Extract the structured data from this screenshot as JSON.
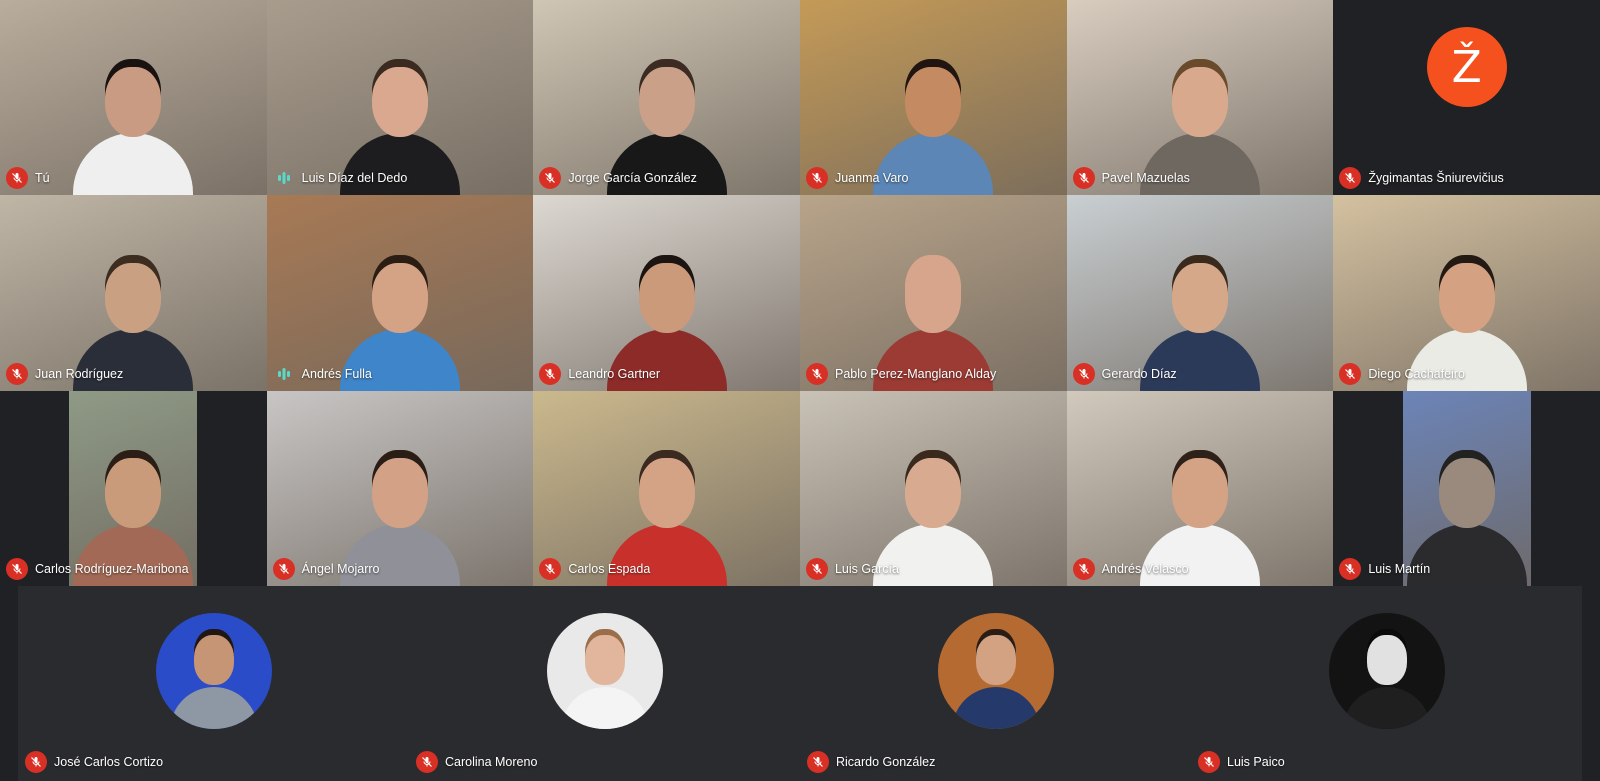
{
  "mic_icon": "mic-off-icon",
  "talking_icon": "audio-level-icon",
  "colors": {
    "background": "#202124",
    "mic_off": "#d93025",
    "speaking": "#5bd9c8",
    "avatar_letter_bg": "#f4511e"
  },
  "participants": [
    {
      "name": "Tú",
      "status": "muted",
      "bg": "#b9ad9c",
      "skin": "#c99b82",
      "shirt": "#efefef",
      "hair": "#1a1210"
    },
    {
      "name": "Luis Díaz del Dedo",
      "status": "speaking",
      "bg": "#a89d8d",
      "skin": "#d9a88e",
      "shirt": "#1d1d1f",
      "hair": "#3a2a20"
    },
    {
      "name": "Jorge García González",
      "status": "muted",
      "bg": "#cfc6b4",
      "skin": "#caa088",
      "shirt": "#181818",
      "hair": "#3b2b22"
    },
    {
      "name": "Juanma Varo",
      "status": "muted",
      "bg": "#c49a57",
      "skin": "#c48a62",
      "shirt": "#5b86b6",
      "hair": "#201510"
    },
    {
      "name": "Pavel Mazuelas",
      "status": "muted",
      "bg": "#d8cdbf",
      "skin": "#d9a98d",
      "shirt": "#6f6860",
      "hair": "#6a4a2d"
    },
    {
      "name": "Žygimantas Šniurevičius",
      "status": "muted",
      "avatar_letter": "Ž"
    },
    {
      "name": "Juan Rodríguez",
      "status": "muted",
      "bg": "#bfb6a6",
      "skin": "#caa083",
      "shirt": "#2a2e38",
      "hair": "#3d2c20"
    },
    {
      "name": "Andrés Fulla",
      "status": "speaking",
      "bg": "#a87a55",
      "skin": "#d4a284",
      "shirt": "#3f85c9",
      "hair": "#2c1d14"
    },
    {
      "name": "Leandro Gartner",
      "status": "muted",
      "bg": "#ddd8d2",
      "skin": "#cb9a7b",
      "shirt": "#8d2b28",
      "hair": "#1b1410"
    },
    {
      "name": "Pablo Perez-Manglano Alday",
      "status": "muted",
      "bg": "#b8a48a",
      "skin": "#d6a58c",
      "shirt": "#9b3b34",
      "hair": "#d6a58c"
    },
    {
      "name": "Gerardo Díaz",
      "status": "muted",
      "bg": "#c9cfd2",
      "skin": "#d5a88a",
      "shirt": "#2c3a5a",
      "hair": "#3a2a1e"
    },
    {
      "name": "Diego Cachafeiro",
      "status": "muted",
      "bg": "#d4c1a0",
      "skin": "#d4a282",
      "shirt": "#ebebe6",
      "hair": "#241a14"
    },
    {
      "name": "Carlos Rodríguez-Maribona",
      "status": "muted",
      "narrow": true,
      "bg": "#8e9a86",
      "skin": "#c99b7b",
      "shirt": "#a26a56",
      "hair": "#2a1e16"
    },
    {
      "name": "Ángel Mojarro",
      "status": "muted",
      "bg": "#c8c6c5",
      "skin": "#d2a186",
      "shirt": "#8f9098",
      "hair": "#2a1d15"
    },
    {
      "name": "Carlos Espada",
      "status": "muted",
      "bg": "#cbb98d",
      "skin": "#d4a385",
      "shirt": "#c8312b",
      "hair": "#3a2a20"
    },
    {
      "name": "Luis García",
      "status": "muted",
      "bg": "#c9c2b6",
      "skin": "#d8ab90",
      "shirt": "#f1f1ef",
      "hair": "#3a2a1e"
    },
    {
      "name": "Andrés Velasco",
      "status": "muted",
      "bg": "#d2c9bd",
      "skin": "#d4a386",
      "shirt": "#f2f2f2",
      "hair": "#2d2119"
    },
    {
      "name": "Luis Martín",
      "status": "muted",
      "narrow": true,
      "bg": "#6c84b8",
      "skin": "#9a8a7e",
      "shirt": "#2b2b2d",
      "hair": "#222"
    }
  ],
  "strip_participants": [
    {
      "name": "José Carlos Cortizo",
      "status": "muted",
      "bg": "#2b4cc8",
      "skin": "#c59575",
      "shirt": "#8e98a4",
      "hair": "#201612"
    },
    {
      "name": "Carolina Moreno",
      "status": "muted",
      "bg": "#e9e9e9",
      "skin": "#e2b69c",
      "shirt": "#f4f4f4",
      "hair": "#9a6e48"
    },
    {
      "name": "Ricardo González",
      "status": "muted",
      "bg": "#b56a32",
      "skin": "#d2a283",
      "shirt": "#253a6a",
      "hair": "#2a1d15"
    },
    {
      "name": "Luis Paico",
      "status": "muted",
      "bg": "#131313",
      "skin": "#e1e1e1",
      "shirt": "#1f1f1f",
      "hair": "#0a0a0a"
    }
  ]
}
